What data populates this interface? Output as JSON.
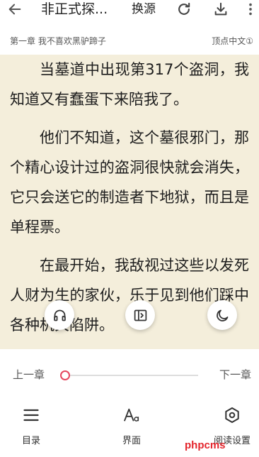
{
  "toolbar": {
    "back_icon": "back-arrow-icon",
    "title": "非正式探...",
    "change_source_label": "换源",
    "refresh_icon": "refresh-icon",
    "download_icon": "download-icon",
    "more_icon": "more-vertical-icon"
  },
  "chapter_bar": {
    "chapter_title": "第一章 我不喜欢黑驴蹄子",
    "source_name": "顶点中文①"
  },
  "content": {
    "paragraphs": [
      "当墓道中出现第317个盗洞，我知道又有蠢蛋下来陪我了。",
      "他们不知道，这个墓很邪门，那个精心设计过的盗洞很快就会消失，它只会送它的制造者下地狱，而且是单程票。",
      "在最开始，我敌视过这些以发死人财为生的家伙，乐于见到他们踩中各种机关陷阱。"
    ]
  },
  "floating_actions": [
    {
      "icon": "headphones-icon"
    },
    {
      "icon": "auto-page-icon"
    },
    {
      "icon": "moon-icon"
    }
  ],
  "chapter_nav": {
    "prev_label": "上一章",
    "next_label": "下一章",
    "progress": 0
  },
  "bottom_nav": [
    {
      "icon": "menu-icon",
      "label": "目录"
    },
    {
      "icon": "font-style-icon",
      "label": "界面"
    },
    {
      "icon": "settings-icon",
      "label": "阅读设置"
    }
  ],
  "watermark": "phpcms",
  "colors": {
    "page_background": "#f4eedb",
    "menu_background": "#ffffff",
    "text": "#1e1e1e",
    "accent": "#e5475f",
    "watermark": "#e4252c"
  }
}
